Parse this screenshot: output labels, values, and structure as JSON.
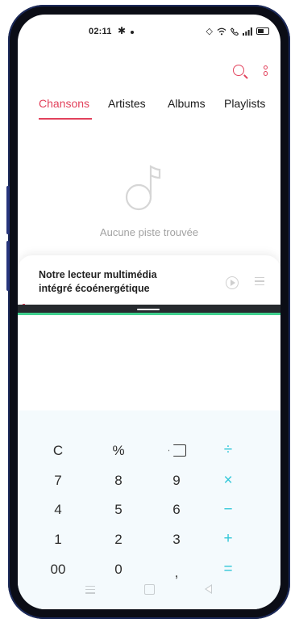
{
  "status_bar": {
    "time": "02:11",
    "gear_icon": "gear-icon",
    "battery_icon": "battery-icon"
  },
  "music_app": {
    "accent_color": "#e2425c",
    "toolbar": {
      "search_icon": "search-icon",
      "more_icon": "more-vertical-icon"
    },
    "tabs": [
      {
        "label": "Chansons",
        "active": true
      },
      {
        "label": "Artistes",
        "active": false
      },
      {
        "label": "Albums",
        "active": false
      },
      {
        "label": "Playlists",
        "active": false
      }
    ],
    "empty_state": {
      "icon": "music-note-icon",
      "text": "Aucune piste trouvée"
    },
    "player": {
      "title_line1": "Notre lecteur multimédia",
      "title_line2": "intégré écoénergétique",
      "play_icon": "play-icon",
      "playlist_icon": "playlist-icon"
    }
  },
  "calculator": {
    "accent_color": "#31c7d8",
    "keys": [
      [
        "C",
        "%",
        "⌫",
        "÷"
      ],
      [
        "7",
        "8",
        "9",
        "×"
      ],
      [
        "4",
        "5",
        "6",
        "−"
      ],
      [
        "1",
        "2",
        "3",
        "+"
      ],
      [
        "00",
        "0",
        ",",
        "="
      ]
    ]
  },
  "nav_bar": {
    "menu_icon": "menu-icon",
    "home_icon": "home-icon",
    "back_icon": "back-icon"
  }
}
